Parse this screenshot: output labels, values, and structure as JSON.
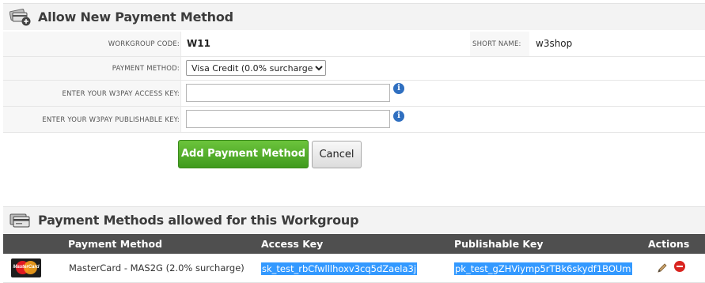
{
  "allow_section": {
    "title": "Allow New Payment Method",
    "workgroup_code_label": "WORKGROUP CODE:",
    "workgroup_code_value": "W11",
    "short_name_label": "SHORT NAME:",
    "short_name_value": "w3shop",
    "payment_method_label": "PAYMENT METHOD:",
    "payment_method_selected": "Visa Credit (0.0% surcharge)",
    "access_key_label": "ENTER YOUR W3PAY ACCESS KEY:",
    "access_key_value": "",
    "publishable_key_label": "ENTER YOUR W3PAY PUBLISHABLE KEY:",
    "publishable_key_value": "",
    "add_button": "Add Payment Method",
    "cancel_button": "Cancel"
  },
  "allowed_section": {
    "title": "Payment Methods allowed for this Workgroup",
    "columns": {
      "payment_method": "Payment Method",
      "access_key": "Access Key",
      "publishable_key": "Publishable Key",
      "actions": "Actions"
    },
    "rows": [
      {
        "card_brand": "MasterCard",
        "payment_method": "MasterCard - MAS2G (2.0% surcharge)",
        "access_key": "sk_test_rbCfwlllhoxv3cq5dZaela3j",
        "publishable_key": "pk_test_gZHViymp5rTBk6skydf1BOUm"
      }
    ]
  },
  "icons": {
    "allow_header": "cards-add-icon",
    "allowed_header": "card-icon",
    "info": "info-icon",
    "edit": "pencil-edit-icon",
    "delete": "remove-icon"
  },
  "colors": {
    "add_button": "#4caf2a",
    "table_header": "#4f4f4f",
    "selection": "#3399ff",
    "info": "#2f6fc0",
    "delete": "#d9241f"
  }
}
